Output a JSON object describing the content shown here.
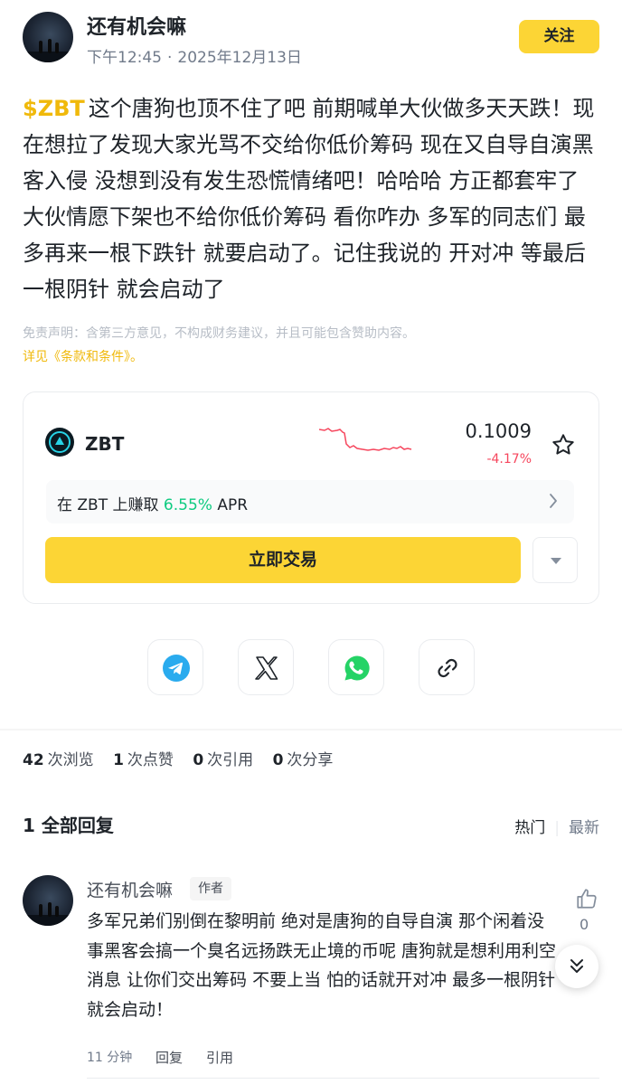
{
  "post": {
    "author": "还有机会嘛",
    "time": "下午12:45",
    "separator": "·",
    "date": "2025年12月13日",
    "follow_label": "关注",
    "ticker": "$ZBT",
    "body": "这个唐狗也顶不住了吧 前期喊单大伙做多天天跌！现在想拉了发现大家光骂不交给你低价筹码 现在又自导自演黑客入侵 没想到没有发生恐慌情绪吧！哈哈哈 方正都套牢了 大伙情愿下架也不给你低价筹码 看你咋办  多军的同志们 最多再来一根下跌针 就要启动了。记住我说的 开对冲 等最后一根阴针 就会启动了",
    "disclaimer": "免责声明：含第三方意见，不构成财务建议，并且可能包含赞助内容。",
    "terms_link": "详见《条款和条件》。"
  },
  "coin_card": {
    "symbol": "ZBT",
    "price": "0.1009",
    "change": "-4.17%",
    "earn_prefix": "在 ZBT 上赚取 ",
    "earn_apr": "6.55%",
    "earn_suffix": " APR",
    "trade_label": "立即交易",
    "sparkline_color": "#f6465d"
  },
  "share_icons": [
    "telegram-icon",
    "x-icon",
    "whatsapp-icon",
    "link-icon"
  ],
  "stats": {
    "views_num": "42",
    "views_label": "次浏览",
    "likes_num": "1",
    "likes_label": "次点赞",
    "quotes_num": "0",
    "quotes_label": "次引用",
    "shares_num": "0",
    "shares_label": "次分享"
  },
  "replies": {
    "title": "1 全部回复",
    "sort_hot": "热门",
    "sort_new": "最新"
  },
  "comment": {
    "author": "还有机会嘛",
    "badge": "作者",
    "text": "多军兄弟们别倒在黎明前 绝对是唐狗的自导自演 那个闲着没事黑客会搞一个臭名远扬跌无止境的币呢 唐狗就是想利用利空消息 让你们交出筹码 不要上当 怕的话就开对冲 最多一根阴针就会启动！",
    "time": "11 分钟",
    "reply_label": "回复",
    "quote_label": "引用",
    "like_count": "0"
  },
  "colors": {
    "accent": "#fcd535",
    "ticker": "#f0b90b",
    "negative": "#f6465d",
    "positive": "#0ecb81"
  }
}
